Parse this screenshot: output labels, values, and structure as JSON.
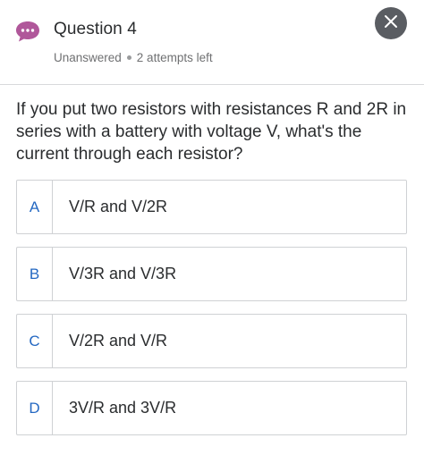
{
  "header": {
    "chat_icon": "chat-bubble-icon",
    "title": "Question 4",
    "status": "Unanswered",
    "attempts": "2 attempts left",
    "close_icon": "close-icon",
    "colors": {
      "chat_icon": "#b0579a",
      "close_button": "#5a5d62",
      "letter_accent": "#2468c2"
    }
  },
  "question": {
    "text": "If you put two resistors with resistances R and 2R in series with a battery with voltage V, what's the current through each resistor?"
  },
  "options": [
    {
      "letter": "A",
      "text": "V/R and V/2R"
    },
    {
      "letter": "B",
      "text": "V/3R and V/3R"
    },
    {
      "letter": "C",
      "text": "V/2R and V/R"
    },
    {
      "letter": "D",
      "text": "3V/R and 3V/R"
    }
  ]
}
